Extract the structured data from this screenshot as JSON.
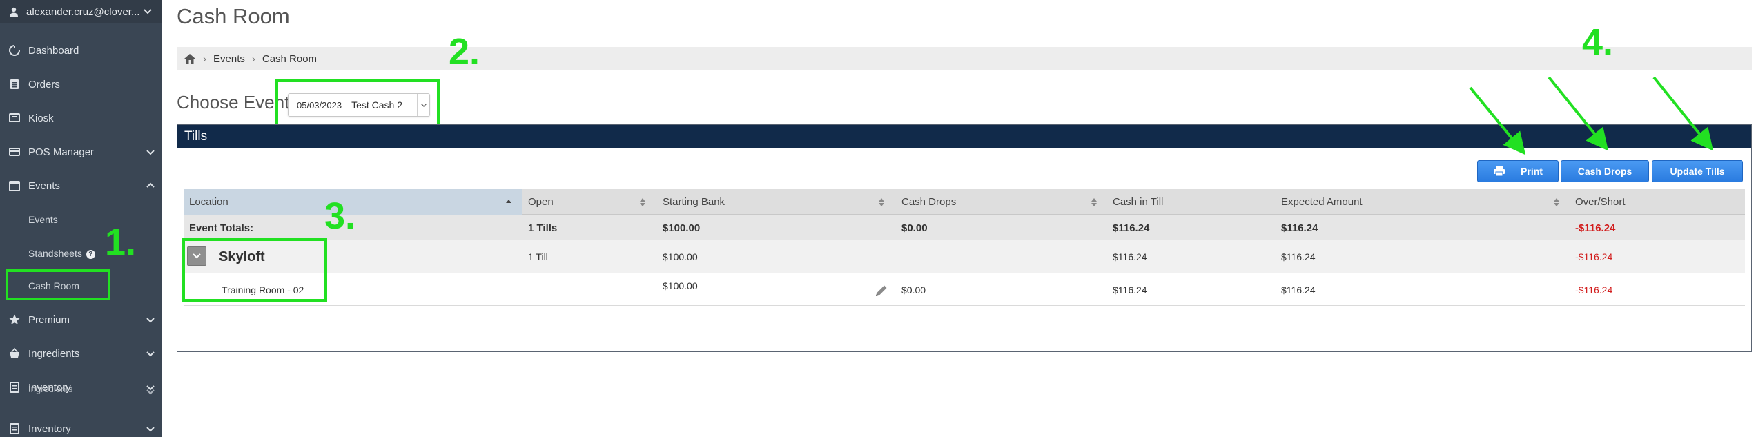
{
  "sidebar": {
    "user": "alexander.cruz@clover...",
    "items": [
      {
        "label": "Dashboard",
        "icon": "dashboard-icon"
      },
      {
        "label": "Orders",
        "icon": "orders-icon"
      },
      {
        "label": "Kiosk",
        "icon": "kiosk-icon"
      },
      {
        "label": "POS Manager",
        "icon": "pos-icon"
      },
      {
        "label": "Events",
        "icon": "calendar-icon"
      },
      {
        "label": "Events"
      },
      {
        "label": "Standsheets"
      },
      {
        "label": "Cash Room"
      },
      {
        "label": "Premium",
        "icon": "star-icon"
      },
      {
        "label": "Ingredients",
        "icon": "basket-icon"
      },
      {
        "label": "Inventory",
        "icon": "inventory-icon"
      },
      {
        "label": "Ingredients"
      },
      {
        "label": "Inventory",
        "icon": "inventory-icon"
      }
    ],
    "help_badge": "?"
  },
  "page": {
    "title": "Cash Room",
    "breadcrumb": [
      "Events",
      "Cash Room"
    ],
    "choose_label": "Choose Event",
    "event_select": {
      "date": "05/03/2023",
      "name": "Test Cash 2"
    }
  },
  "annotations": [
    "1.",
    "2.",
    "3.",
    "4."
  ],
  "tills": {
    "title": "Tills",
    "buttons": {
      "print": "Print",
      "cash_drops": "Cash Drops",
      "update": "Update Tills"
    },
    "columns": [
      "Location",
      "Open",
      "Starting Bank",
      "Cash Drops",
      "Cash in Till",
      "Expected Amount",
      "Over/Short"
    ],
    "totals": {
      "label": "Event Totals:",
      "open": "1 Tills",
      "starting_bank": "$100.00",
      "cash_drops": "$0.00",
      "cash_in_till": "$116.24",
      "expected": "$116.24",
      "over_short": "-$116.24"
    },
    "group": {
      "name": "Skyloft",
      "open": "1 Till",
      "starting_bank": "$100.00",
      "cash_in_till": "$116.24",
      "expected": "$116.24",
      "over_short": "-$116.24"
    },
    "detail": {
      "name": "Training Room - 02",
      "starting_bank": "$100.00",
      "cash_drops": "$0.00",
      "cash_in_till": "$116.24",
      "expected": "$116.24",
      "over_short": "-$116.24"
    }
  },
  "colors": {
    "annotation": "#22e022",
    "panel_header": "#112a4a",
    "button": "#2a7ce0",
    "negative": "#d21d1d",
    "sidebar": "#3a4654"
  }
}
